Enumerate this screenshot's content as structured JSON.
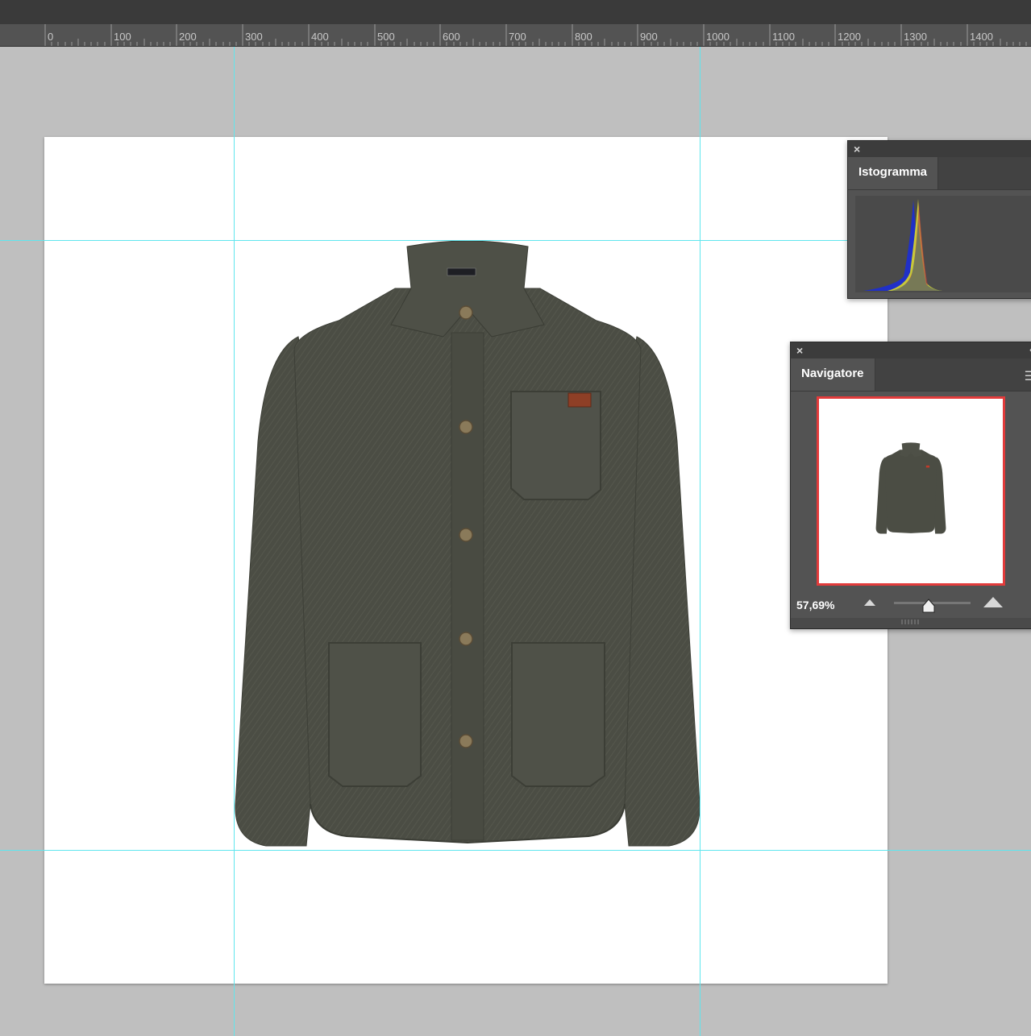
{
  "ruler": {
    "labels": [
      "0",
      "100",
      "200",
      "300",
      "400",
      "500",
      "600",
      "700",
      "800",
      "900",
      "1000",
      "1100",
      "1200",
      "1300",
      "1400"
    ]
  },
  "histogram_panel": {
    "tab_label": "Istogramma",
    "close_icon": "close-icon"
  },
  "navigator_panel": {
    "tab_label": "Navigatore",
    "zoom_value": "57,69%",
    "close_icon": "close-icon",
    "collapse_icon": "double-chevron-left-icon",
    "menu_icon": "hamburger-menu-icon",
    "zoom_out_icon": "small-mountain-icon",
    "zoom_in_icon": "large-mountain-icon",
    "zoom_slider_fraction": 0.45,
    "preview_border_color": "#e23b3b"
  },
  "colors": {
    "guide": "#5fe6ee",
    "jacket": "#4a4c43",
    "panel": "#535353"
  }
}
